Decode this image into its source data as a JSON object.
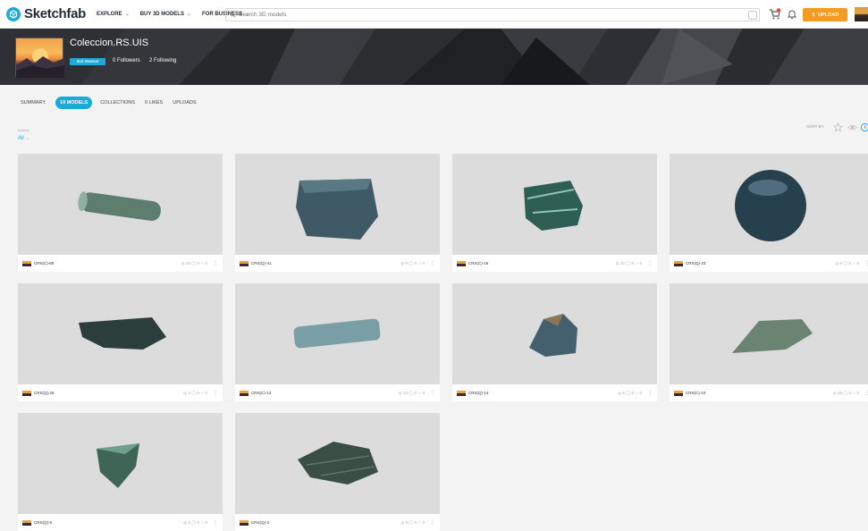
{
  "topbar": {
    "brand": "Sketchfab",
    "nav": [
      {
        "label": "EXPLORE",
        "dropdown": true
      },
      {
        "label": "BUY 3D MODELS",
        "dropdown": true
      },
      {
        "label": "FOR BUSINESS",
        "dropdown": true
      }
    ],
    "search_placeholder": "Search 3D models",
    "upload_label": "UPLOAD",
    "icons": [
      "cart-icon",
      "bell-icon",
      "upload-icon"
    ]
  },
  "profile": {
    "name": "Coleccion.RS.UIS",
    "edit_label": "EDIT PROFILE",
    "followers": "0 Followers",
    "following": "2 Following"
  },
  "tabs": [
    {
      "label": "SUMMARY",
      "active": false
    },
    {
      "label": "10 MODELS",
      "active": true
    },
    {
      "label": "COLLECTIONS",
      "active": false
    },
    {
      "label": "0 LIKES",
      "active": false
    },
    {
      "label": "UPLOADS",
      "active": false
    }
  ],
  "filter": {
    "label": "Animal",
    "value": "All"
  },
  "sort": {
    "label": "SORT BY"
  },
  "models": [
    {
      "name": "CRS(C)-80",
      "stats": "◎ 10  ◯ 0  ☆ 0",
      "rock_color": "#5d7d6f",
      "shape": "cylinder"
    },
    {
      "name": "CRS(Q)-41",
      "stats": "◎ 9  ◯ 0  ☆ 0",
      "rock_color": "#3f5a66",
      "shape": "block"
    },
    {
      "name": "CRS(C)-16",
      "stats": "◎ 10  ◯ 0  ☆ 0",
      "rock_color": "#2f5e55",
      "shape": "chunk"
    },
    {
      "name": "CRS(Q)-23",
      "stats": "◎ 6  ◯ 0  ☆ 0",
      "rock_color": "#27404e",
      "shape": "sphere"
    },
    {
      "name": "CRS(Q)-28",
      "stats": "◎ 4  ◯ 0  ☆ 0",
      "rock_color": "#2c3e3c",
      "shape": "flat"
    },
    {
      "name": "CRS(C)-13",
      "stats": "◎ 13  ◯ 0  ☆ 0",
      "rock_color": "#7a9ea6",
      "shape": "bar"
    },
    {
      "name": "CRS(Q)-14",
      "stats": "◎ 6  ◯ 0  ☆ 0",
      "rock_color": "#44606e",
      "shape": "pile"
    },
    {
      "name": "CRS(C)-10",
      "stats": "◎ 16  ◯ 0  ☆ 0",
      "rock_color": "#6b8471",
      "shape": "wedge"
    },
    {
      "name": "CRS(Q)-6",
      "stats": "◎ 2  ◯ 0  ☆ 0",
      "rock_color": "#3e6555",
      "shape": "shard"
    },
    {
      "name": "CRS(Q)-3",
      "stats": "◎ 9  ◯ 0  ☆ 0",
      "rock_color": "#3b4e46",
      "shape": "slab"
    }
  ]
}
